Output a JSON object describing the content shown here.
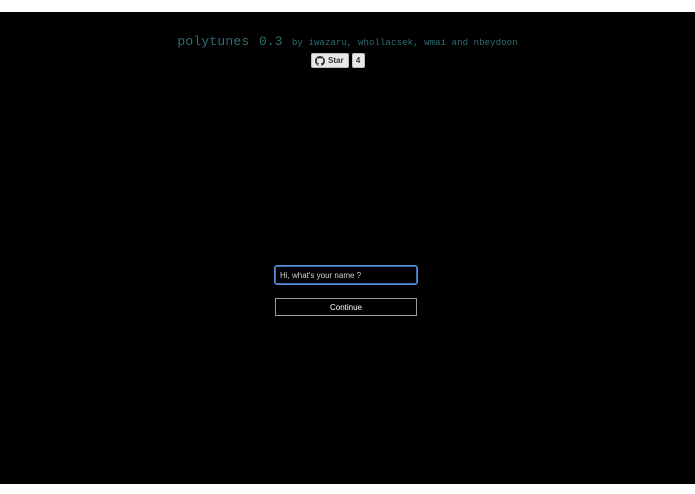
{
  "header": {
    "title": "polytunes",
    "version": "0.3",
    "byline": "by iwazaru, whollacsek, wmai and nbeydoon"
  },
  "github": {
    "star_label": "Star",
    "star_count": "4",
    "icon": "github-octocat-icon"
  },
  "form": {
    "name_placeholder": "Hi, what's your name ?",
    "name_value": "",
    "continue_label": "Continue"
  },
  "colors": {
    "background": "#000000",
    "header_text": "#2f6e73",
    "input_focus_border": "#3b6fb6"
  }
}
